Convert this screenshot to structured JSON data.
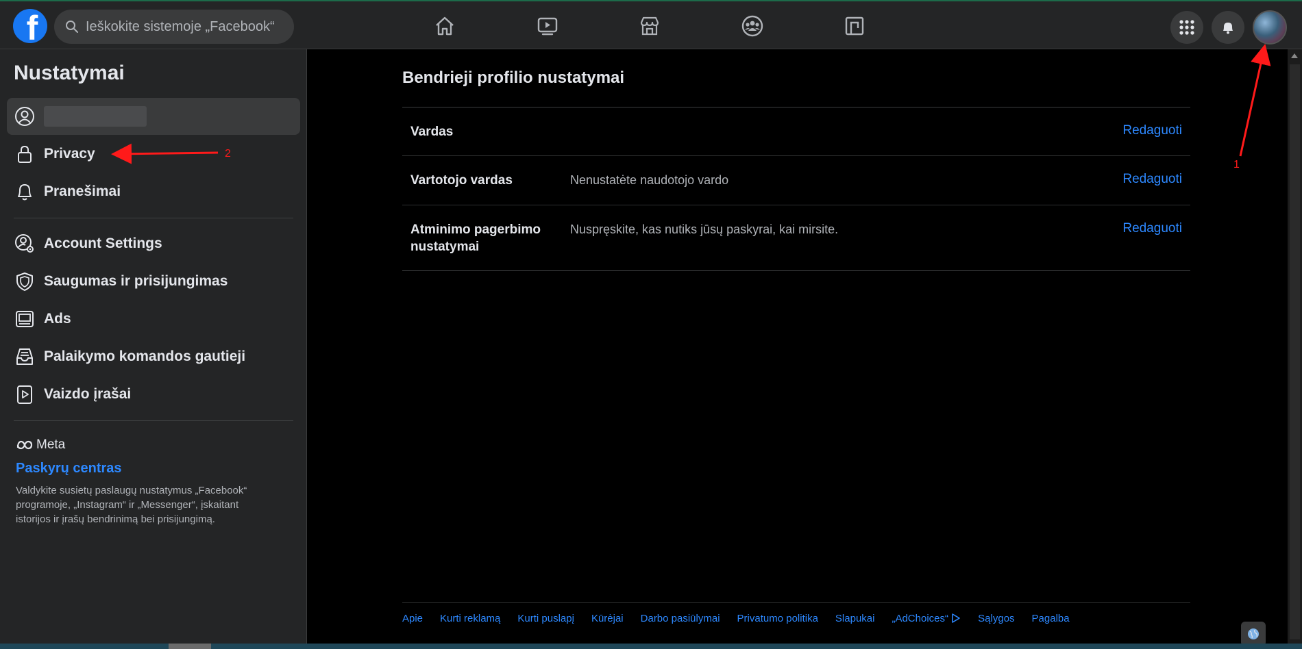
{
  "search": {
    "placeholder": "Ieškokite sistemoje „Facebook“"
  },
  "sidebar": {
    "title": "Nustatymai",
    "items": [
      {
        "label": "Privacy",
        "icon": "lock-icon"
      },
      {
        "label": "Pranešimai",
        "icon": "bell-icon"
      },
      {
        "label": "Account Settings",
        "icon": "user-gear-icon"
      },
      {
        "label": "Saugumas ir prisijungimas",
        "icon": "shield-icon"
      },
      {
        "label": "Ads",
        "icon": "ads-icon"
      },
      {
        "label": "Palaikymo komandos gautieji",
        "icon": "inbox-icon"
      },
      {
        "label": "Vaizdo įrašai",
        "icon": "video-icon"
      }
    ],
    "meta": {
      "logo_text": "Meta",
      "link": "Paskyrų centras",
      "description": "Valdykite susietų paslaugų nustatymus „Facebook“ programoje, „Instagram“ ir „Messenger“, įskaitant istorijos ir įrašų bendrinimą bei prisijungimą."
    }
  },
  "main": {
    "title": "Bendrieji profilio nustatymai",
    "rows": [
      {
        "key": "Vardas",
        "value": "",
        "action": "Redaguoti"
      },
      {
        "key": "Vartotojo vardas",
        "value": "Nenustatėte naudotojo vardo",
        "action": "Redaguoti"
      },
      {
        "key": "Atminimo pagerbimo nustatymai",
        "value": "Nuspręskite, kas nutiks jūsų paskyrai, kai mirsite.",
        "action": "Redaguoti"
      }
    ]
  },
  "footer": [
    "Apie",
    "Kurti reklamą",
    "Kurti puslapį",
    "Kūrėjai",
    "Darbo pasiūlymai",
    "Privatumo politika",
    "Slapukai",
    "„AdChoices“",
    "Sąlygos",
    "Pagalba"
  ],
  "annotations": {
    "one": "1",
    "two": "2"
  },
  "colors": {
    "accent": "#2d88ff",
    "brand": "#1877f2",
    "annotation": "#ff1a1a"
  }
}
